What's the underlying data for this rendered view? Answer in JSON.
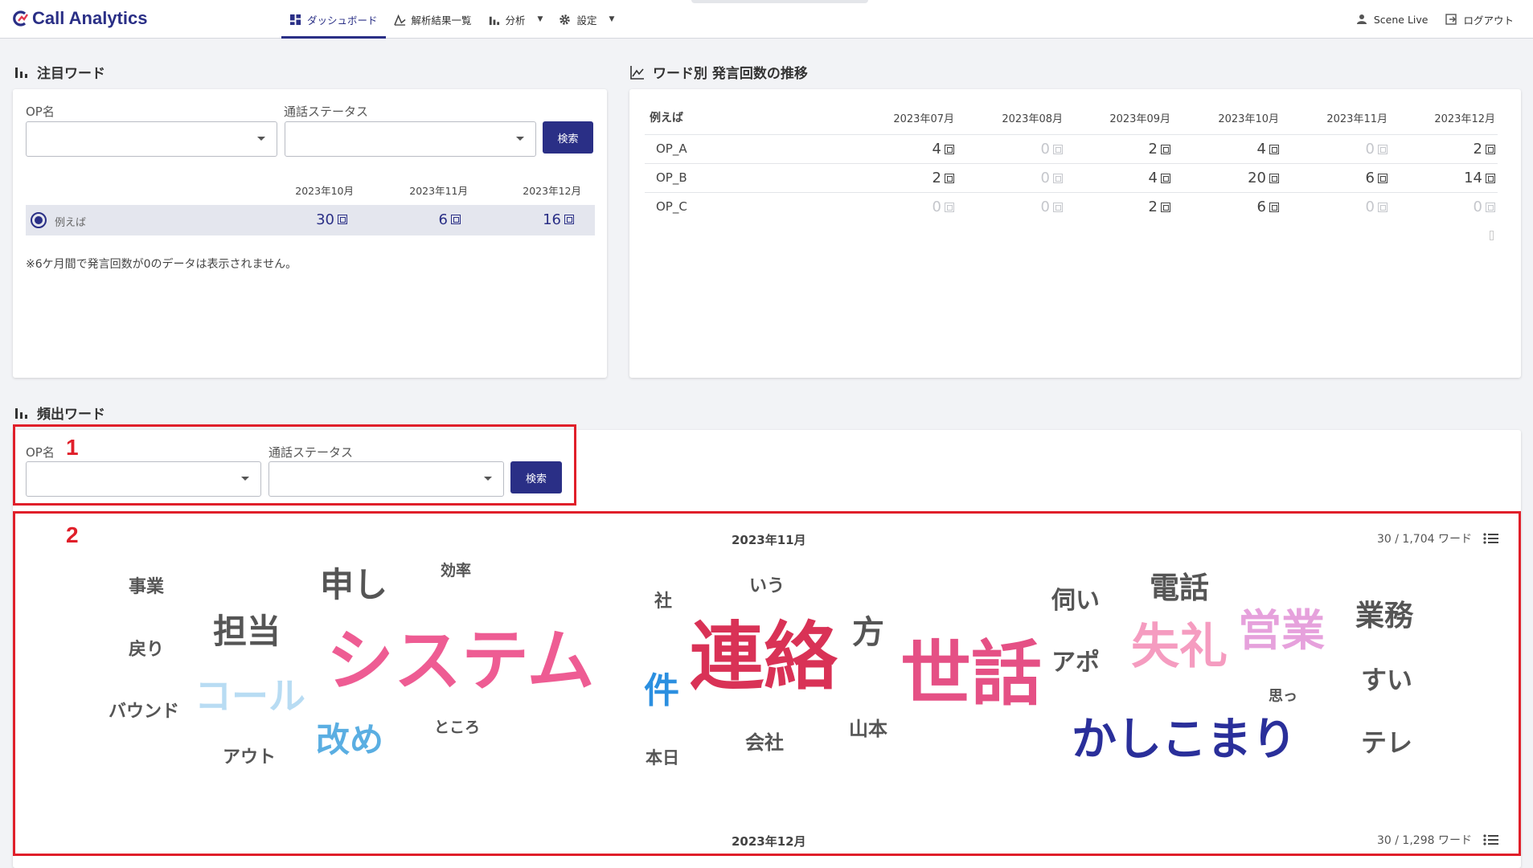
{
  "app": {
    "title": "Call Analytics"
  },
  "nav": {
    "dashboard": "ダッシュボード",
    "results": "解析結果一覧",
    "analysis": "分析",
    "settings": "設定",
    "user": "Scene Live",
    "logout": "ログアウト"
  },
  "focus": {
    "title": "注目ワード",
    "op_label": "OP名",
    "status_label": "通話ステータス",
    "op_value": "",
    "status_value": "",
    "search": "検索",
    "months": [
      "2023年10月",
      "2023年11月",
      "2023年12月"
    ],
    "row": {
      "word": "例えば",
      "counts": [
        "30",
        "6",
        "16"
      ]
    },
    "note": "※6ケ月間で発言回数が0のデータは表示されません。"
  },
  "trend": {
    "title": "ワード別 発言回数の推移",
    "word": "例えば",
    "months": [
      "2023年07月",
      "2023年08月",
      "2023年09月",
      "2023年10月",
      "2023年11月",
      "2023年12月"
    ],
    "rows": [
      {
        "name": "OP_A",
        "values": [
          "4",
          "0",
          "2",
          "4",
          "0",
          "2"
        ]
      },
      {
        "name": "OP_B",
        "values": [
          "2",
          "0",
          "4",
          "20",
          "6",
          "14"
        ]
      },
      {
        "name": "OP_C",
        "values": [
          "0",
          "0",
          "2",
          "6",
          "0",
          "0"
        ]
      }
    ]
  },
  "frequent": {
    "title": "頻出ワード",
    "op_label": "OP名",
    "status_label": "通話ステータス",
    "op_value": "",
    "status_value": "",
    "search": "検索",
    "annotation_1": "1",
    "annotation_2": "2",
    "month_top": "2023年11月",
    "count_top": "30 / 1,704 ワード",
    "month_bottom": "2023年12月",
    "count_bottom": "30 / 1,298 ワード",
    "words": [
      "事業",
      "戻り",
      "バウンド",
      "担当",
      "アウト",
      "申し",
      "コール",
      "改め",
      "効率",
      "システム",
      "ところ",
      "社",
      "いう",
      "件",
      "本日",
      "連絡",
      "会社",
      "方",
      "山本",
      "世話",
      "伺い",
      "アポ",
      "電話",
      "失礼",
      "営業",
      "かしこまり",
      "思っ",
      "業務",
      "すい",
      "テレ"
    ]
  },
  "colors": {
    "brand": "#2a2f86",
    "annotation": "#e01f2a",
    "word_gray": "#555555",
    "word_pink": "#ee5c93",
    "word_red": "#d93256",
    "word_navy": "#2a2f9a",
    "word_lightblue": "#b8dcf3",
    "word_blue": "#5aaee2",
    "word_brightblue": "#2b8fe0",
    "word_lightpink": "#f59cc0",
    "word_lavender": "#e6a1dc"
  }
}
